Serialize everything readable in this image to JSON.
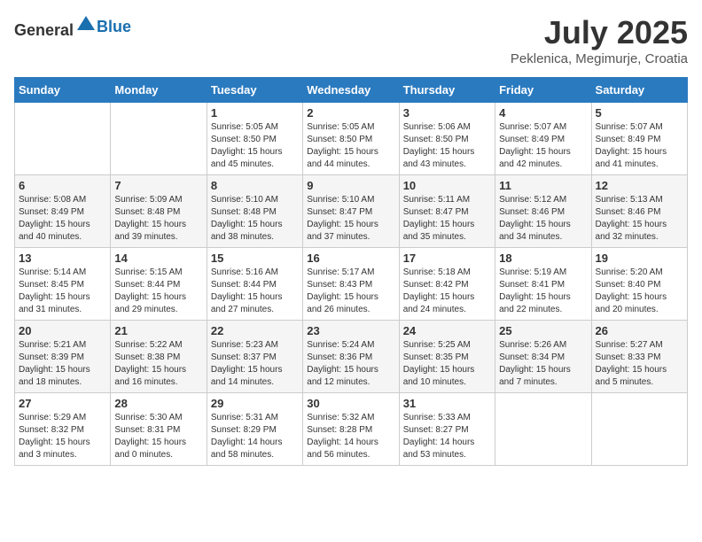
{
  "header": {
    "logo_general": "General",
    "logo_blue": "Blue",
    "month": "July 2025",
    "location": "Peklenica, Megimurje, Croatia"
  },
  "weekdays": [
    "Sunday",
    "Monday",
    "Tuesday",
    "Wednesday",
    "Thursday",
    "Friday",
    "Saturday"
  ],
  "weeks": [
    [
      {
        "day": "",
        "text": ""
      },
      {
        "day": "",
        "text": ""
      },
      {
        "day": "1",
        "text": "Sunrise: 5:05 AM\nSunset: 8:50 PM\nDaylight: 15 hours and 45 minutes."
      },
      {
        "day": "2",
        "text": "Sunrise: 5:05 AM\nSunset: 8:50 PM\nDaylight: 15 hours and 44 minutes."
      },
      {
        "day": "3",
        "text": "Sunrise: 5:06 AM\nSunset: 8:50 PM\nDaylight: 15 hours and 43 minutes."
      },
      {
        "day": "4",
        "text": "Sunrise: 5:07 AM\nSunset: 8:49 PM\nDaylight: 15 hours and 42 minutes."
      },
      {
        "day": "5",
        "text": "Sunrise: 5:07 AM\nSunset: 8:49 PM\nDaylight: 15 hours and 41 minutes."
      }
    ],
    [
      {
        "day": "6",
        "text": "Sunrise: 5:08 AM\nSunset: 8:49 PM\nDaylight: 15 hours and 40 minutes."
      },
      {
        "day": "7",
        "text": "Sunrise: 5:09 AM\nSunset: 8:48 PM\nDaylight: 15 hours and 39 minutes."
      },
      {
        "day": "8",
        "text": "Sunrise: 5:10 AM\nSunset: 8:48 PM\nDaylight: 15 hours and 38 minutes."
      },
      {
        "day": "9",
        "text": "Sunrise: 5:10 AM\nSunset: 8:47 PM\nDaylight: 15 hours and 37 minutes."
      },
      {
        "day": "10",
        "text": "Sunrise: 5:11 AM\nSunset: 8:47 PM\nDaylight: 15 hours and 35 minutes."
      },
      {
        "day": "11",
        "text": "Sunrise: 5:12 AM\nSunset: 8:46 PM\nDaylight: 15 hours and 34 minutes."
      },
      {
        "day": "12",
        "text": "Sunrise: 5:13 AM\nSunset: 8:46 PM\nDaylight: 15 hours and 32 minutes."
      }
    ],
    [
      {
        "day": "13",
        "text": "Sunrise: 5:14 AM\nSunset: 8:45 PM\nDaylight: 15 hours and 31 minutes."
      },
      {
        "day": "14",
        "text": "Sunrise: 5:15 AM\nSunset: 8:44 PM\nDaylight: 15 hours and 29 minutes."
      },
      {
        "day": "15",
        "text": "Sunrise: 5:16 AM\nSunset: 8:44 PM\nDaylight: 15 hours and 27 minutes."
      },
      {
        "day": "16",
        "text": "Sunrise: 5:17 AM\nSunset: 8:43 PM\nDaylight: 15 hours and 26 minutes."
      },
      {
        "day": "17",
        "text": "Sunrise: 5:18 AM\nSunset: 8:42 PM\nDaylight: 15 hours and 24 minutes."
      },
      {
        "day": "18",
        "text": "Sunrise: 5:19 AM\nSunset: 8:41 PM\nDaylight: 15 hours and 22 minutes."
      },
      {
        "day": "19",
        "text": "Sunrise: 5:20 AM\nSunset: 8:40 PM\nDaylight: 15 hours and 20 minutes."
      }
    ],
    [
      {
        "day": "20",
        "text": "Sunrise: 5:21 AM\nSunset: 8:39 PM\nDaylight: 15 hours and 18 minutes."
      },
      {
        "day": "21",
        "text": "Sunrise: 5:22 AM\nSunset: 8:38 PM\nDaylight: 15 hours and 16 minutes."
      },
      {
        "day": "22",
        "text": "Sunrise: 5:23 AM\nSunset: 8:37 PM\nDaylight: 15 hours and 14 minutes."
      },
      {
        "day": "23",
        "text": "Sunrise: 5:24 AM\nSunset: 8:36 PM\nDaylight: 15 hours and 12 minutes."
      },
      {
        "day": "24",
        "text": "Sunrise: 5:25 AM\nSunset: 8:35 PM\nDaylight: 15 hours and 10 minutes."
      },
      {
        "day": "25",
        "text": "Sunrise: 5:26 AM\nSunset: 8:34 PM\nDaylight: 15 hours and 7 minutes."
      },
      {
        "day": "26",
        "text": "Sunrise: 5:27 AM\nSunset: 8:33 PM\nDaylight: 15 hours and 5 minutes."
      }
    ],
    [
      {
        "day": "27",
        "text": "Sunrise: 5:29 AM\nSunset: 8:32 PM\nDaylight: 15 hours and 3 minutes."
      },
      {
        "day": "28",
        "text": "Sunrise: 5:30 AM\nSunset: 8:31 PM\nDaylight: 15 hours and 0 minutes."
      },
      {
        "day": "29",
        "text": "Sunrise: 5:31 AM\nSunset: 8:29 PM\nDaylight: 14 hours and 58 minutes."
      },
      {
        "day": "30",
        "text": "Sunrise: 5:32 AM\nSunset: 8:28 PM\nDaylight: 14 hours and 56 minutes."
      },
      {
        "day": "31",
        "text": "Sunrise: 5:33 AM\nSunset: 8:27 PM\nDaylight: 14 hours and 53 minutes."
      },
      {
        "day": "",
        "text": ""
      },
      {
        "day": "",
        "text": ""
      }
    ]
  ]
}
